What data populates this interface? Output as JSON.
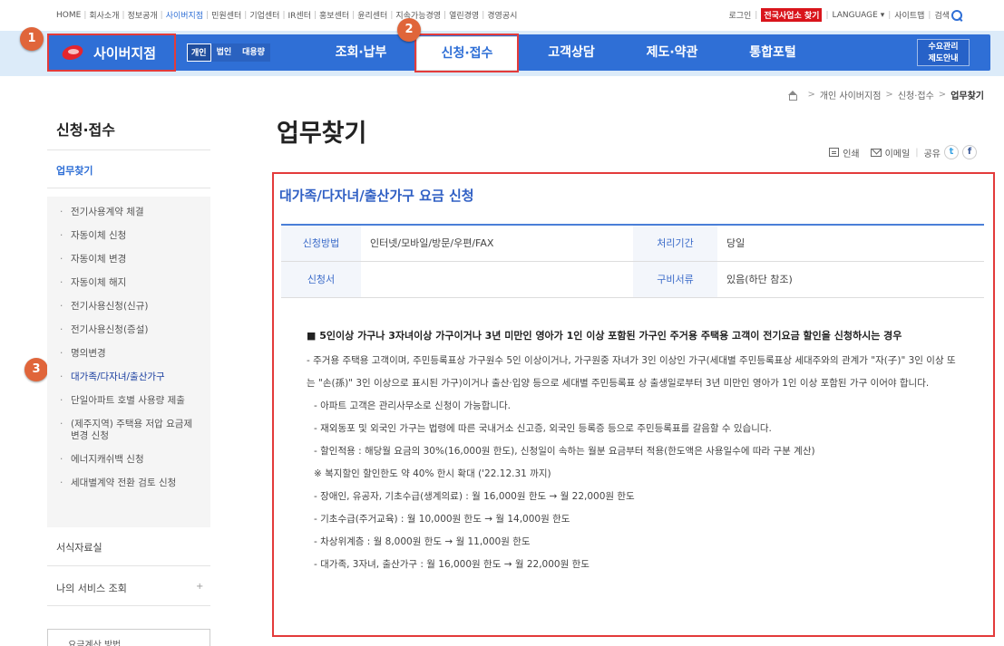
{
  "util_nav": {
    "left": [
      "HOME",
      "회사소개",
      "정보공개",
      "사이버지점",
      "민원센터",
      "기업센터",
      "IR센터",
      "홍보센터",
      "윤리센터",
      "지속가능경영",
      "열린경영",
      "경영공시"
    ],
    "active_index": 3,
    "login": "로그인",
    "red_button": "전국사업소 찾기",
    "language": "LANGUAGE",
    "sitemap": "사이트맵",
    "search": "검색"
  },
  "header": {
    "logo_text": "사이버지점",
    "segments": [
      "개인",
      "법인",
      "대용량"
    ],
    "menu": [
      "조회·납부",
      "신청·접수",
      "고객상담",
      "제도·약관",
      "통합포털"
    ],
    "active_menu_index": 1,
    "side_button_line1": "수요관리",
    "side_button_line2": "제도안내"
  },
  "markers": [
    "1",
    "2",
    "3"
  ],
  "breadcrumb": [
    "개인 사이버지점",
    "신청·접수",
    "업무찾기"
  ],
  "sidebar": {
    "title": "신청·접수",
    "current": "업무찾기",
    "items": [
      "전기사용계약 체결",
      "자동이체 신청",
      "자동이체 변경",
      "자동이체 해지",
      "전기사용신청(신규)",
      "전기사용신청(증설)",
      "명의변경",
      "대가족/다자녀/출산가구",
      "단일아파트 호별 사용량 제출",
      "(제주지역) 주택용 저압 요금제 변경 신청",
      "에너지캐쉬백 신청",
      "세대별계약 전환 검토 신청"
    ],
    "selected_index": 7,
    "bottom1": "서식자료실",
    "bottom2": "나의 서비스 조회",
    "bottom2_expand": "+",
    "bottom3": "요금계산 방법"
  },
  "page": {
    "title": "업무찾기",
    "print": "인쇄",
    "email": "이메일",
    "share": "공유",
    "twitter": "t",
    "facebook": "f"
  },
  "content": {
    "title": "대가족/다자녀/출산가구 요금 신청",
    "rows": [
      {
        "h1": "신청방법",
        "v1": "인터넷/모바일/방문/우편/FAX",
        "h2": "처리기간",
        "v2": "당일"
      },
      {
        "h1": "신청서",
        "v1": "",
        "h2": "구비서류",
        "v2": "있음(하단 참조)"
      }
    ],
    "lead": "■ 5인이상 가구나 3자녀이상 가구이거나 3년 미만인 영아가 1인 이상 포함된 가구인 주거용 주택용 고객이 전기요금 할인을 신청하시는 경우",
    "para": "- 주거용 주택용 고객이며, 주민등록표상 가구원수 5인 이상이거나, 가구원중 자녀가 3인 이상인 가구(세대별 주민등록표상 세대주와의 관계가 \"자(子)\" 3인 이상 또는 \"손(孫)\" 3인 이상으로 표시된 가구)이거나 출산·입양 등으로 세대별 주민등록표 상 출생일로부터 3년 미만인 영아가 1인 이상 포함된 가구 이어야 합니다.",
    "lines": [
      "- 아파트 고객은 관리사무소로 신청이 가능합니다.",
      "- 재외동포 및 외국인 가구는 법령에 따른 국내거소 신고증, 외국인 등록증 등으로 주민등록표를 갈음할 수 있습니다.",
      "- 할인적용 : 해당월 요금의 30%(16,000원 한도), 신청일이 속하는 월분 요금부터 적용(한도액은 사용일수에 따라 구분 계산)",
      "※ 복지할인 할인한도 약 40% 한시 확대 ('22.12.31 까지)",
      "- 장애인, 유공자, 기초수급(생계의료) : 월 16,000원 한도 → 월 22,000원 한도",
      "- 기초수급(주거교육) : 월 10,000원 한도 → 월 14,000원 한도",
      "- 차상위계층 : 월 8,000원 한도 → 월 11,000원 한도",
      "- 대가족, 3자녀, 출산가구 : 월 16,000원 한도 → 월 22,000원 한도"
    ]
  },
  "colors": {
    "brand_blue": "#2f6fd6",
    "highlight_red": "#e33b3b",
    "marker_orange": "#e0653a"
  }
}
